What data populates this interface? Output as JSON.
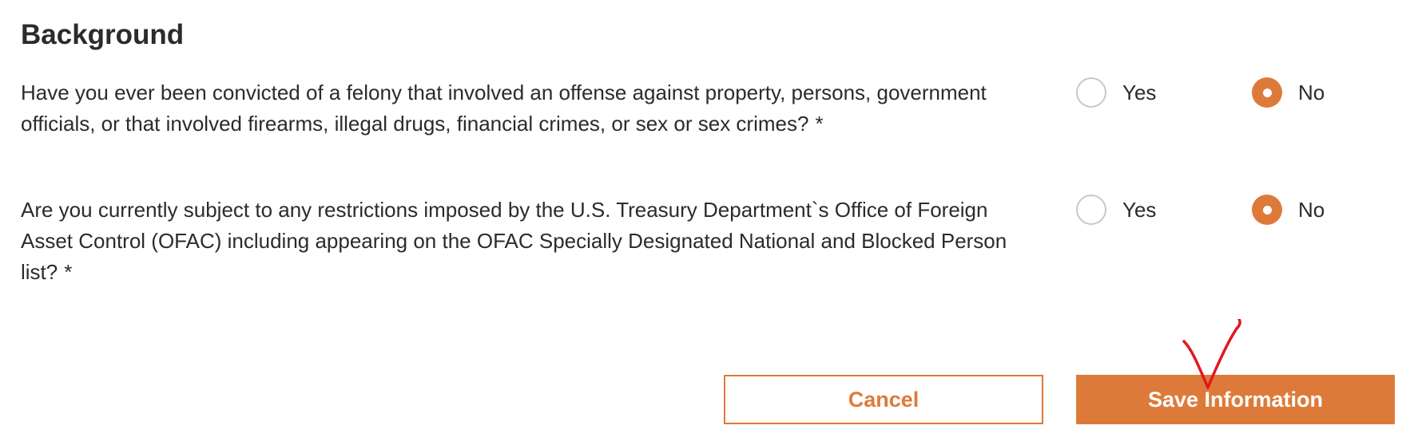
{
  "section": {
    "title": "Background"
  },
  "questions": [
    {
      "text": "Have you ever been convicted of a felony that involved an offense against property, persons, government officials, or that involved firearms, illegal drugs, financial crimes, or sex or sex crimes?",
      "required_marker": "*",
      "options": [
        "Yes",
        "No"
      ],
      "selected": "No"
    },
    {
      "text": "Are you currently subject to any restrictions imposed by the U.S. Treasury Department`s Office of Foreign Asset Control (OFAC) including appearing on the OFAC Specially Designated National and Blocked Person list?",
      "required_marker": "*",
      "options": [
        "Yes",
        "No"
      ],
      "selected": "No"
    }
  ],
  "actions": {
    "cancel_label": "Cancel",
    "save_label": "Save Information"
  },
  "colors": {
    "accent": "#de7a39",
    "text": "#2b2b2b",
    "radio_border": "#c9c9c9",
    "annotation": "#e0191e"
  },
  "annotation": {
    "icon": "red-checkmark-icon"
  }
}
